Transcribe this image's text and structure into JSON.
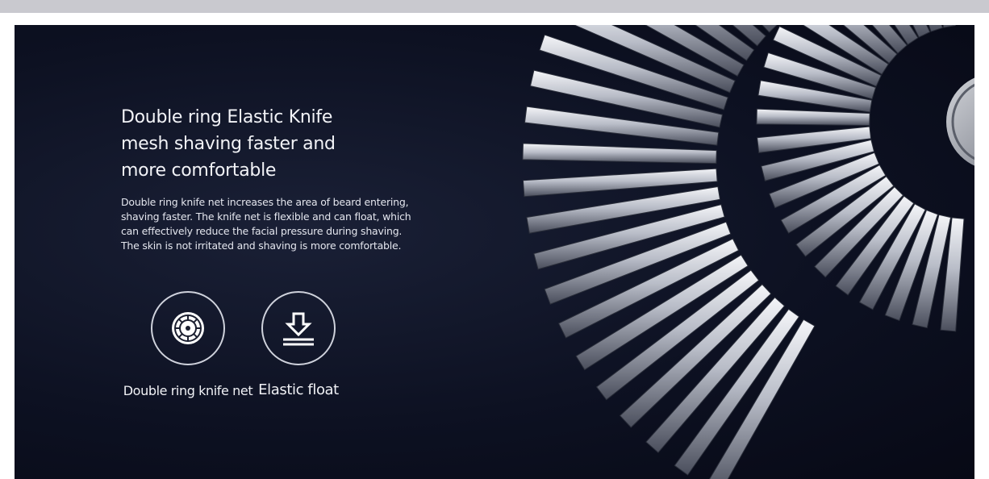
{
  "section": {
    "headline": "Double ring Elastic Knife mesh shaving faster and more comfortable",
    "description": "Double ring knife net increases the area of beard entering, shaving faster. The knife net is flexible and can float, which can effectively reduce the facial pressure during shaving. The skin is not irritated and shaving is more comfortable."
  },
  "features": [
    {
      "label": "Double ring knife net",
      "icon": "double-ring-knife-net-icon"
    },
    {
      "label": "Elastic float",
      "icon": "elastic-float-icon"
    }
  ],
  "colors": {
    "background": "#0d1122",
    "text": "#f2f3f7",
    "metal": "#c8ccd6"
  }
}
